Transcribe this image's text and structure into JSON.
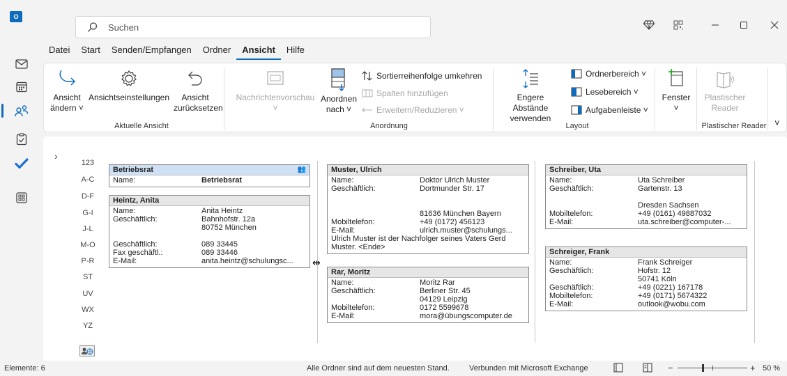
{
  "app": {
    "icon": "outlook-icon",
    "icon_label": "O"
  },
  "search": {
    "placeholder": "Suchen"
  },
  "menu": {
    "tabs": [
      "Datei",
      "Start",
      "Senden/Empfangen",
      "Ordner",
      "Ansicht",
      "Hilfe"
    ],
    "active": "Ansicht"
  },
  "ribbon": {
    "ansicht_aendern": [
      "Ansicht",
      "ändern ˅"
    ],
    "ansichtseinstellungen": "Ansichtseinstellungen",
    "ansicht_zuruecksetzen": [
      "Ansicht",
      "zurücksetzen"
    ],
    "group_aktuelle_ansicht": "Aktuelle Ansicht",
    "nachrichtenvorschau": [
      "Nachrichtenvorschau",
      "˅"
    ],
    "anordnen_nach": [
      "Anordnen",
      "nach ˅"
    ],
    "sortierreihenfolge": "Sortierreihenfolge umkehren",
    "spalten_hinzufuegen": "Spalten hinzufügen",
    "erweitern_reduzieren": "Erweitern/Reduzieren ˅",
    "group_anordnung": "Anordnung",
    "engere_abstaende": [
      "Engere Abstände",
      "verwenden"
    ],
    "ordnerbereich": "Ordnerbereich ˅",
    "lesebereich": "Lesebereich ˅",
    "aufgabenleiste": "Aufgabenleiste ˅",
    "group_layout": "Layout",
    "fenster": [
      "Fenster",
      "˅"
    ],
    "plastischer_reader": [
      "Plastischer",
      "Reader"
    ],
    "group_plastischer_reader": "Plastischer Reader",
    "collapse_chevron": "˅"
  },
  "alpha_index": [
    "123",
    "A-C",
    "D-F",
    "G-I",
    "J-L",
    "M-O",
    "P-R",
    "ST",
    "UV",
    "WX",
    "YZ"
  ],
  "cards": {
    "betriebsrat": {
      "title": "Betriebsrat",
      "rows": [
        [
          "Name:",
          "Betriebsrat"
        ]
      ]
    },
    "heintz": {
      "title": "Heintz, Anita",
      "rows": [
        [
          "Name:",
          "Anita Heintz"
        ],
        [
          "Geschäftlich:",
          "Bahnhofstr. 12a"
        ],
        [
          "",
          "80752 München"
        ],
        [
          "",
          ""
        ],
        [
          "Geschäftlich:",
          "089 33445"
        ],
        [
          "Fax geschäftl.:",
          "089 33446"
        ],
        [
          "E-Mail:",
          "anita.heintz@schulungsc..."
        ]
      ]
    },
    "muster": {
      "title": "Muster, Ulrich",
      "rows": [
        [
          "Name:",
          "Doktor Ulrich Muster"
        ],
        [
          "Geschäftlich:",
          "Dortmunder Str. 17"
        ],
        [
          "",
          ""
        ],
        [
          "",
          "81636  München  Bayern"
        ],
        [
          "Mobiltelefon:",
          "+49 (0172) 456123"
        ],
        [
          "E-Mail:",
          "ulrich.muster@schulungs..."
        ]
      ],
      "note": "Ulrich Muster ist der Nachfolger seines Vaters Gerd Muster. <Ende>"
    },
    "rar": {
      "title": "Rar, Moritz",
      "rows": [
        [
          "Name:",
          "Moritz Rar"
        ],
        [
          "Geschäftlich:",
          "Berliner Str. 45"
        ],
        [
          "",
          "04129 Leipzig"
        ],
        [
          "Mobiltelefon:",
          "0172 5599678"
        ],
        [
          "E-Mail:",
          "mora@übungscomputer.de"
        ]
      ]
    },
    "schreiber": {
      "title": "Schreiber, Uta",
      "rows": [
        [
          "Name:",
          "Uta Schreiber"
        ],
        [
          "Geschäftlich:",
          "Gartenstr. 13"
        ],
        [
          "",
          ""
        ],
        [
          "",
          "Dresden  Sachsen"
        ],
        [
          "Mobiltelefon:",
          "+49 (0161) 49887032"
        ],
        [
          "E-Mail:",
          "uta.schreiber@computer-..."
        ]
      ]
    },
    "schreiger": {
      "title": "Schreiger, Frank",
      "rows": [
        [
          "Name:",
          "Frank Schreiger"
        ],
        [
          "Geschäftlich:",
          "Hofstr. 12"
        ],
        [
          "",
          "50741 Köln"
        ],
        [
          "Geschäftlich:",
          "+49 (0221) 167178"
        ],
        [
          "Mobiltelefon:",
          "+49 (0171) 5674322"
        ],
        [
          "E-Mail:",
          "outlook@wobu.com"
        ]
      ]
    }
  },
  "status": {
    "items": "Elemente: 6",
    "sync": "Alle Ordner sind auf dem neuesten Stand.",
    "connection": "Verbunden mit Microsoft Exchange",
    "zoom_minus": "−",
    "zoom_plus": "+",
    "zoom": "50 %",
    "zoom_level_percent": 50
  }
}
